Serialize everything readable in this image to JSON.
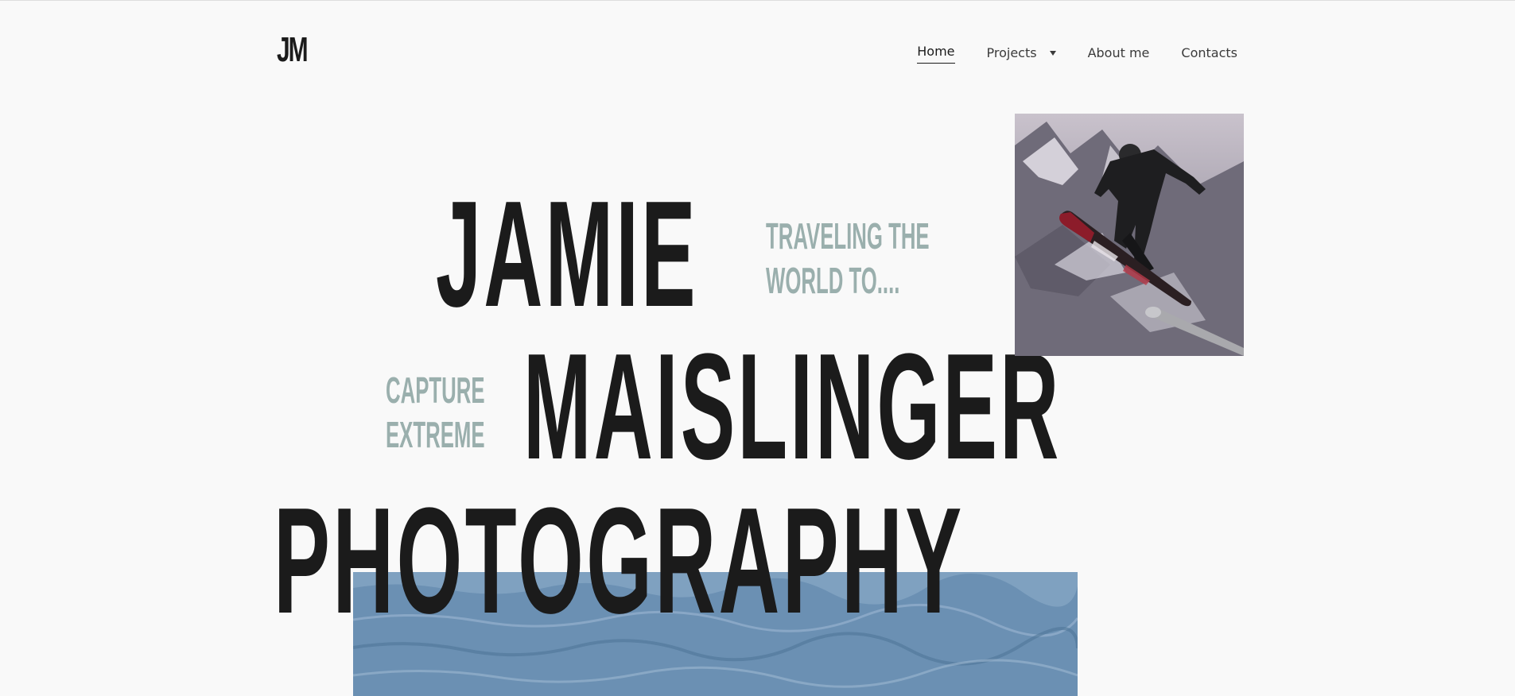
{
  "header": {
    "logo": "JM",
    "nav": [
      {
        "label": "Home",
        "active": true
      },
      {
        "label": "Projects",
        "has_dropdown": true
      },
      {
        "label": "About me"
      },
      {
        "label": "Contacts"
      }
    ]
  },
  "hero": {
    "line1": "JAMIE",
    "line2": "MAISLINGER",
    "line3": "PHOTOGRAPHY",
    "tagline_top": [
      "TRAVELING THE",
      "WORLD TO...."
    ],
    "tagline_side": [
      "CAPTURE",
      "EXTREME"
    ]
  },
  "colors": {
    "background": "#f9f9f9",
    "text": "#1b1b1b",
    "accent": "#9aafad"
  }
}
